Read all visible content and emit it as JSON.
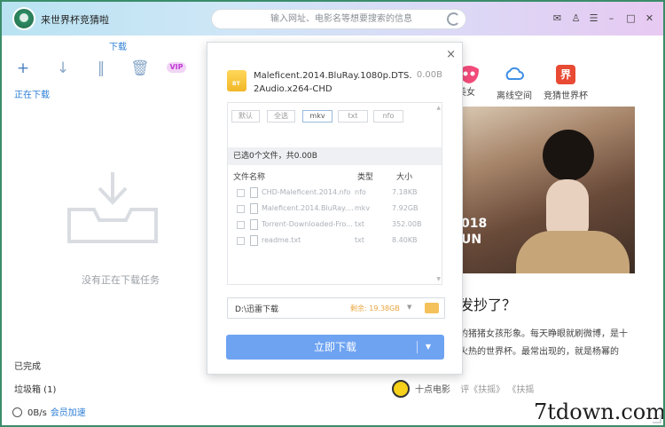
{
  "app": {
    "title": "来世界杯竞猜啦",
    "address_placeholder": "输入网址、电影名等想要搜索的信息"
  },
  "left_panel": {
    "tab_label": "下载",
    "vip_label": "VIP",
    "section_downloading": "正在下载",
    "empty_text": "没有正在下载任务",
    "completed": "已完成",
    "trash": "垃圾箱 (1)",
    "speed": "0B/s",
    "accelerate_link": "会员加速"
  },
  "main_panel": {
    "nav_items": [
      "美女",
      "离线空间",
      "竞猜世界杯"
    ],
    "poster_text_1": "018",
    "poster_text_2": "UN",
    "headline": "发抄了？",
    "snippet_line_1": "的猪猪女孩形象。每天睁眼就刷微博，是十",
    "snippet_line_2": "火热的世界杯。最常出现的，就是杨幂的",
    "source_name": "十点电影",
    "source_tags": "评《扶摇》 《扶摇",
    "watermark": "7tdown.com"
  },
  "dialog": {
    "file_name": "Maleficent.2014.BluRay.1080p.DTS.2Audio.x264-CHD",
    "file_size": "0.00B",
    "filters": [
      "默认",
      "全选",
      "mkv",
      "txt",
      "nfo"
    ],
    "selected_summary": "已选0个文件，共0.00B",
    "columns": {
      "name": "文件名称",
      "type": "类型",
      "size": "大小"
    },
    "files": [
      {
        "name": "CHD-Maleficent.2014.nfo",
        "type": "nfo",
        "size": "7.18KB"
      },
      {
        "name": "Maleficent.2014.BluRay....",
        "type": "mkv",
        "size": "7.92GB"
      },
      {
        "name": "Torrent-Downloaded-Fro...",
        "type": "txt",
        "size": "352.00B"
      },
      {
        "name": "readme.txt",
        "type": "txt",
        "size": "8.40KB"
      }
    ],
    "save_path": "D:\\迅雷下载",
    "free_space": "剩余: 19.38GB",
    "download_button": "立即下载"
  }
}
